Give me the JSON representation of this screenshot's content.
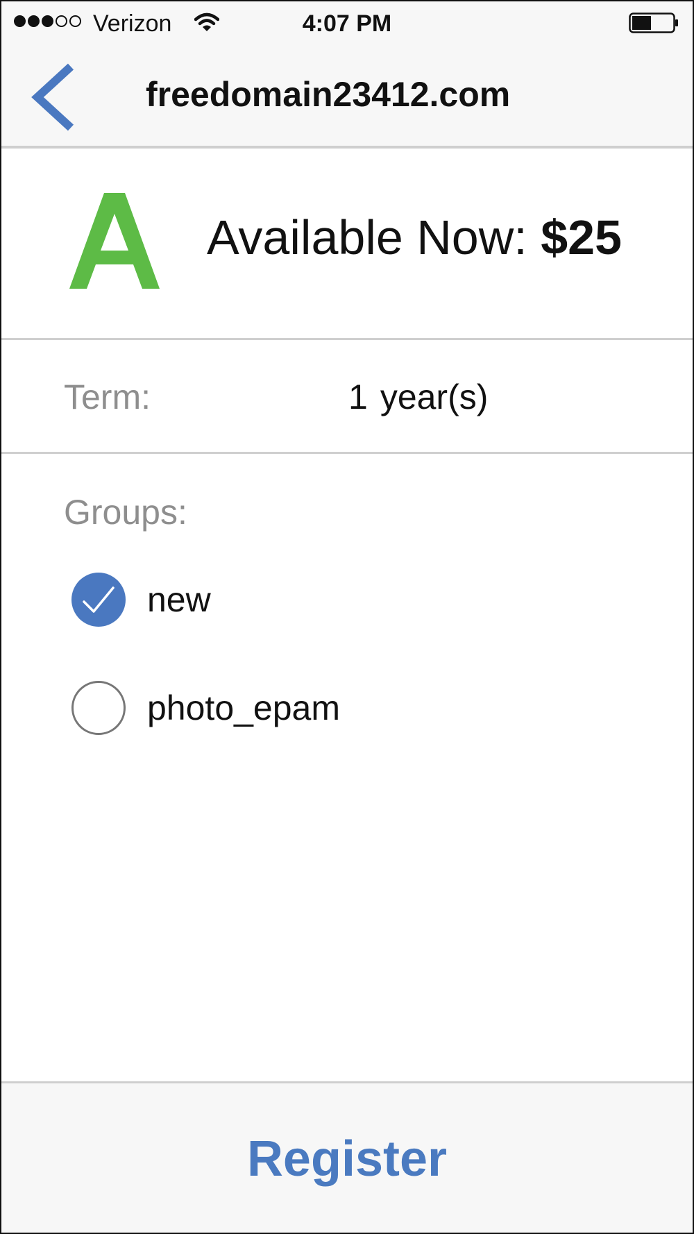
{
  "status_bar": {
    "carrier": "Verizon",
    "time": "4:07 PM",
    "signal_bars_filled": 3,
    "signal_bars_total": 5,
    "battery_level": 0.45
  },
  "nav": {
    "title": "freedomain23412.com",
    "back_icon": "chevron-left-icon"
  },
  "availability": {
    "grade_letter": "A",
    "label": "Available Now:",
    "price": "$25",
    "grade_color": "#5dbb46"
  },
  "term": {
    "label": "Term:",
    "value_number": "1",
    "value_unit": "year(s)"
  },
  "groups": {
    "label": "Groups:",
    "items": [
      {
        "name": "new",
        "checked": true
      },
      {
        "name": "photo_epam",
        "checked": false
      }
    ]
  },
  "register": {
    "label": "Register"
  },
  "colors": {
    "accent": "#4a78c0",
    "separator": "#cfcfcf",
    "muted_text": "#8e8e8e"
  }
}
